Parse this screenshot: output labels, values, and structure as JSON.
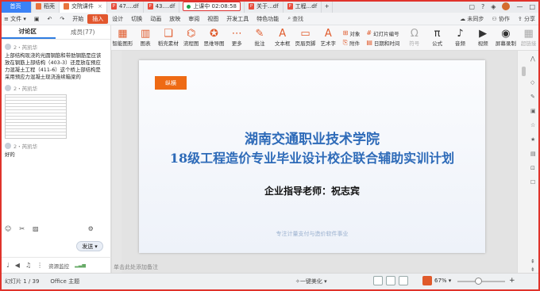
{
  "tabs": {
    "home": "首页",
    "t1": "稻壳",
    "t2": "交院课件",
    "t3": "47....df",
    "t4": "43....df",
    "timer_label": "上课中 02:08:58",
    "t5": "关于...df",
    "t6": "工程...df",
    "avatar_count": "6"
  },
  "menubar": {
    "file": "文件",
    "items": [
      "开始",
      "插入",
      "设计",
      "切换",
      "动画",
      "放映",
      "审阅",
      "视图",
      "开发工具",
      "特色功能"
    ],
    "search": "查找",
    "sync": "未同步",
    "collab": "协作",
    "share": "分享"
  },
  "left_panel": {
    "tab_discuss": "讨论区",
    "tab_members": "成员(77)",
    "messages": [
      {
        "user": "2・芮凯华",
        "text": "上部结构现浇的光圆钢筋和带肋钢筋是应该放在钢筋上部结构（403-3）还是放在预应力混凝土工程（411-6）这个桥上部结构是采用预应力混凝土现浇连续箱梁的"
      },
      {
        "user": "2・芮凯华",
        "text": ""
      },
      {
        "user": "2・芮凯华",
        "text": "好的"
      }
    ],
    "send_label": "发送",
    "bottom_label": "资源监控"
  },
  "ribbon": {
    "big": [
      {
        "icon": "▦",
        "label": "智能图形"
      },
      {
        "icon": "▥",
        "label": "图表"
      },
      {
        "icon": "❏",
        "label": "稻壳素材"
      },
      {
        "icon": "⌬",
        "label": "流程图"
      },
      {
        "icon": "✪",
        "label": "思维导图"
      },
      {
        "icon": "⋯",
        "label": "更多"
      },
      {
        "icon": "✎",
        "label": "批注"
      },
      {
        "icon": "A",
        "label": "文本框"
      },
      {
        "icon": "▭",
        "label": "页眉页脚"
      },
      {
        "icon": "A",
        "label": "艺术字"
      }
    ],
    "small": [
      {
        "icon": "⊞",
        "label": "对象"
      },
      {
        "icon": "⎘",
        "label": "附件"
      },
      {
        "icon": "#",
        "label": "幻灯片编号"
      },
      {
        "icon": "▤",
        "label": "日期和时间"
      }
    ],
    "right": [
      {
        "icon": "Ω",
        "label": "符号"
      },
      {
        "icon": "π",
        "label": "公式"
      },
      {
        "icon": "♪",
        "label": "音频"
      },
      {
        "icon": "▶",
        "label": "视频"
      },
      {
        "icon": "◉",
        "label": "屏幕录制"
      },
      {
        "icon": "▦",
        "label": "超链接"
      }
    ]
  },
  "slide": {
    "logo_text": "纵横",
    "title_line1": "湖南交通职业技术学院",
    "title_line2": "18级工程造价专业毕业设计校企联合辅助实训计划",
    "teacher": "企业指导老师：祝志宾",
    "slogan": "专注计量支付与造价软件事业",
    "notes_placeholder": "单击此处添加备注"
  },
  "statusbar": {
    "slide_pos": "幻灯片 1 / 39",
    "theme": "Office 主题",
    "beautify": "一键美化",
    "zoom": "67%"
  }
}
